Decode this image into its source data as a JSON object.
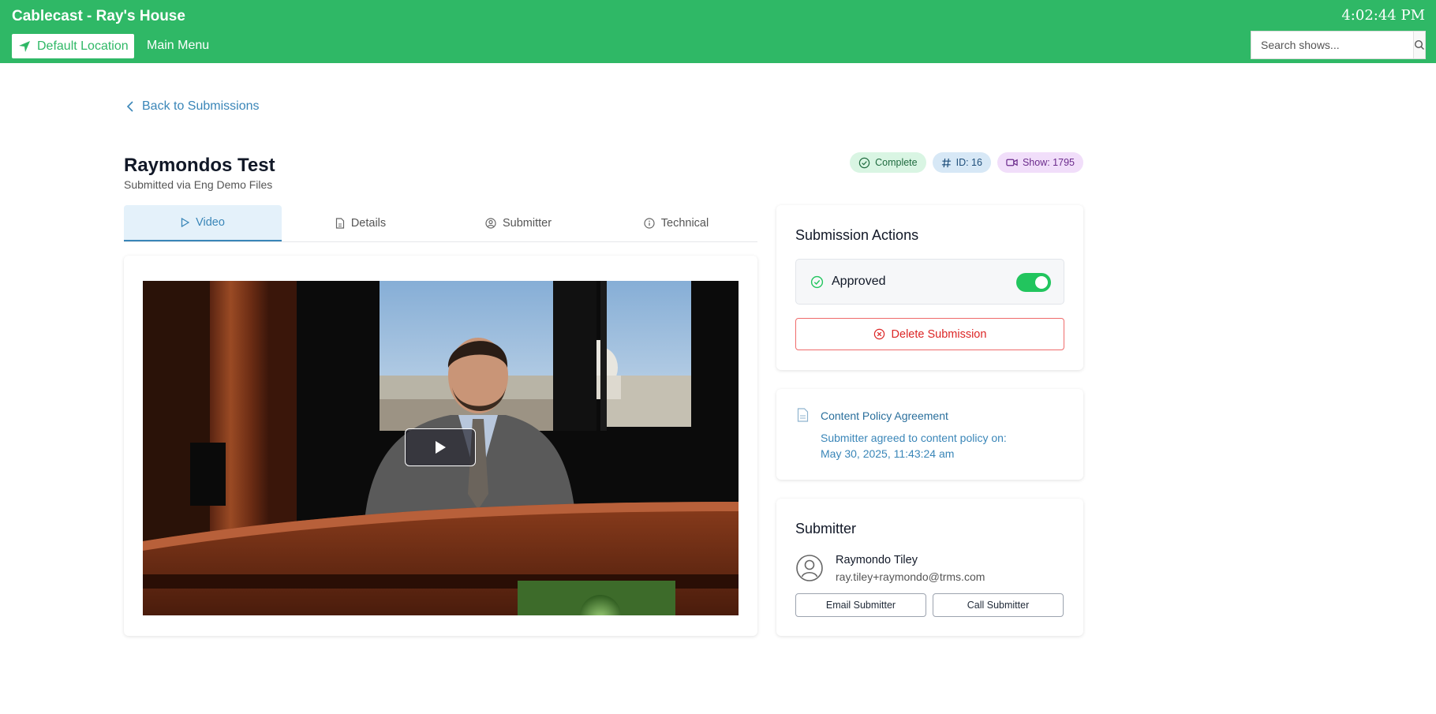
{
  "header": {
    "title": "Cablecast - Ray's House",
    "clock": "4:02:44 PM",
    "location_label": "Default Location",
    "main_menu_label": "Main Menu",
    "search_placeholder": "Search shows..."
  },
  "nav": {
    "back_label": "Back to Submissions"
  },
  "submission": {
    "title": "Raymondos Test",
    "subtitle": "Submitted via Eng Demo Files",
    "badges": {
      "status": "Complete",
      "id": "ID: 16",
      "show": "Show: 1795"
    }
  },
  "tabs": [
    {
      "label": "Video",
      "active": true
    },
    {
      "label": "Details",
      "active": false
    },
    {
      "label": "Submitter",
      "active": false
    },
    {
      "label": "Technical",
      "active": false
    }
  ],
  "actions": {
    "title": "Submission Actions",
    "approved_label": "Approved",
    "approved": true,
    "delete_label": "Delete Submission"
  },
  "policy": {
    "title": "Content Policy Agreement",
    "line1": "Submitter agreed to content policy on:",
    "line2": "May 30, 2025, 11:43:24 am"
  },
  "submitter": {
    "title": "Submitter",
    "name": "Raymondo Tiley",
    "email": "ray.tiley+raymondo@trms.com",
    "email_button": "Email Submitter",
    "call_button": "Call Submitter"
  },
  "colors": {
    "brand_green": "#2fb866",
    "accent_blue": "#3a86b8",
    "danger_red": "#dc2626",
    "toggle_green": "#22c55e"
  }
}
